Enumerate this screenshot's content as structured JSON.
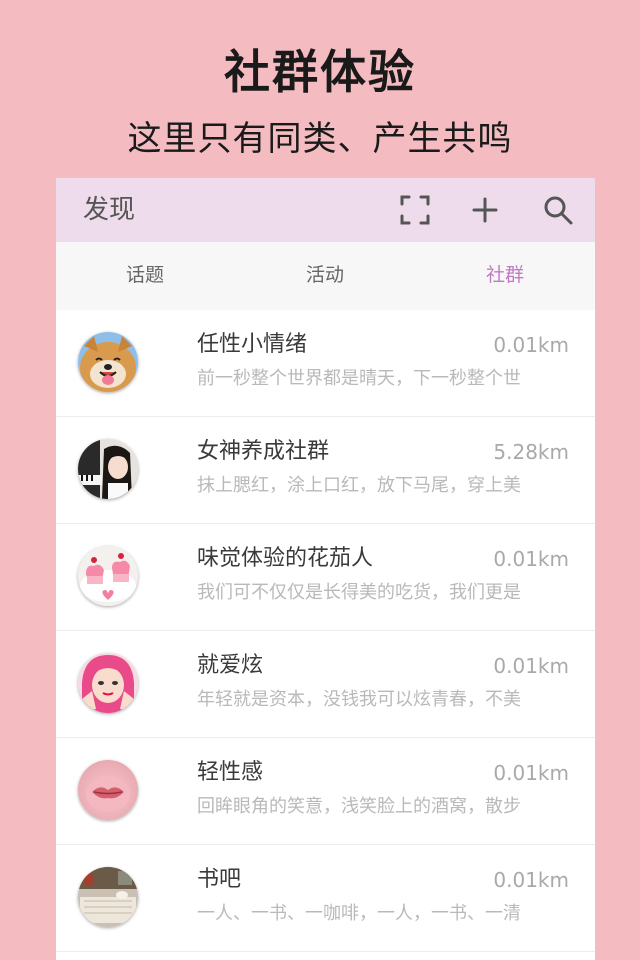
{
  "promo": {
    "title": "社群体验",
    "subtitle": "这里只有同类、产生共鸣"
  },
  "topbar": {
    "title": "发现",
    "icons": [
      "scan-icon",
      "plus-icon",
      "search-icon"
    ]
  },
  "tabs": [
    {
      "label": "话题",
      "active": false
    },
    {
      "label": "活动",
      "active": false
    },
    {
      "label": "社群",
      "active": true
    }
  ],
  "colors": {
    "background": "#f4bcc1",
    "topbar": "#eedcec",
    "active_tab": "#c27ac4"
  },
  "communities": [
    {
      "name": "任性小情绪",
      "distance": "0.01km",
      "desc": "前一秒整个世界都是晴天，下一秒整个世",
      "avatar": "shiba-dog-avatar"
    },
    {
      "name": "女神养成社群",
      "distance": "5.28km",
      "desc": "抹上腮红，涂上口红，放下马尾，穿上美",
      "avatar": "girl-piano-avatar"
    },
    {
      "name": "味觉体验的花茄人",
      "distance": "0.01km",
      "desc": "我们可不仅仅是长得美的吃货，我们更是",
      "avatar": "heart-cakes-avatar"
    },
    {
      "name": "就爱炫",
      "distance": "0.01km",
      "desc": "年轻就是资本，没钱我可以炫青春，不美",
      "avatar": "pink-hair-girl-avatar"
    },
    {
      "name": "轻性感",
      "distance": "0.01km",
      "desc": "回眸眼角的笑意，浅笑脸上的酒窝，散步",
      "avatar": "lips-avatar"
    },
    {
      "name": "书吧",
      "distance": "0.01km",
      "desc": "一人、一书、一咖啡，一人，一书、一清",
      "avatar": "book-cafe-avatar"
    }
  ]
}
